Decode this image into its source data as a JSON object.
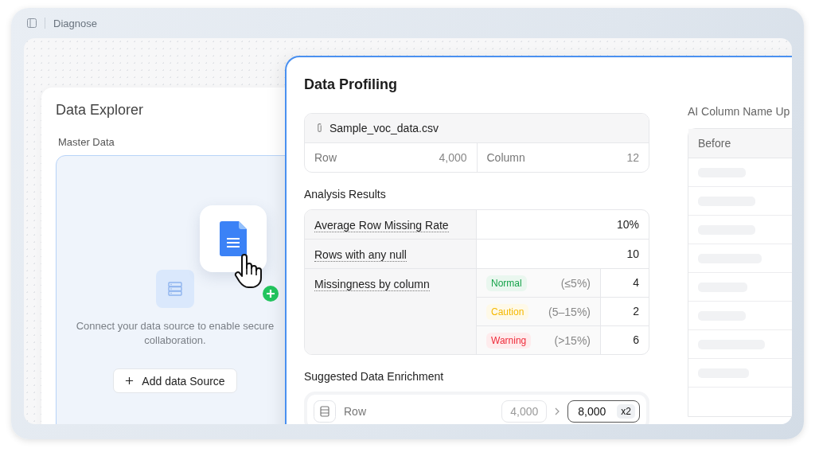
{
  "header": {
    "title": "Diagnose"
  },
  "explorer": {
    "title": "Data Explorer",
    "section": "Master Data",
    "message": "Connect your data source to enable secure collaboration.",
    "button": "Add data Source"
  },
  "profiling": {
    "title": "Data Profiling",
    "file": {
      "name": "Sample_voc_data.csv",
      "stats": [
        {
          "label": "Row",
          "value": "4,000"
        },
        {
          "label": "Column",
          "value": "12"
        }
      ]
    },
    "analysis": {
      "title": "Analysis Results",
      "rows": [
        {
          "label": "Average Row Missing Rate",
          "value": "10%"
        },
        {
          "label": "Rows with any null",
          "value": "10"
        }
      ],
      "breakdown": {
        "label": "Missingness by column",
        "levels": [
          {
            "status": "Normal",
            "range": "(≤5%)",
            "count": "4",
            "color": "#16a34a"
          },
          {
            "status": "Caution",
            "range": "(5–15%)",
            "count": "2",
            "color": "#f5b800"
          },
          {
            "status": "Warning",
            "range": "(>15%)",
            "count": "6",
            "color": "#ef2b3a"
          }
        ]
      }
    },
    "enrichment": {
      "title": "Suggested Data Enrichment",
      "items": [
        {
          "label": "Row",
          "from": "4,000",
          "to": "8,000",
          "multiplier": "x2"
        }
      ]
    },
    "rename": {
      "title": "AI Column Name Up",
      "columns": [
        "Before"
      ],
      "rows": [
        {
          "kind": "loading"
        },
        {
          "kind": "loading"
        },
        {
          "kind": "loading"
        },
        {
          "kind": "loading"
        },
        {
          "kind": "loading"
        },
        {
          "kind": "loading"
        },
        {
          "kind": "loading"
        },
        {
          "kind": "loading"
        },
        {
          "kind": "empty"
        }
      ]
    }
  }
}
